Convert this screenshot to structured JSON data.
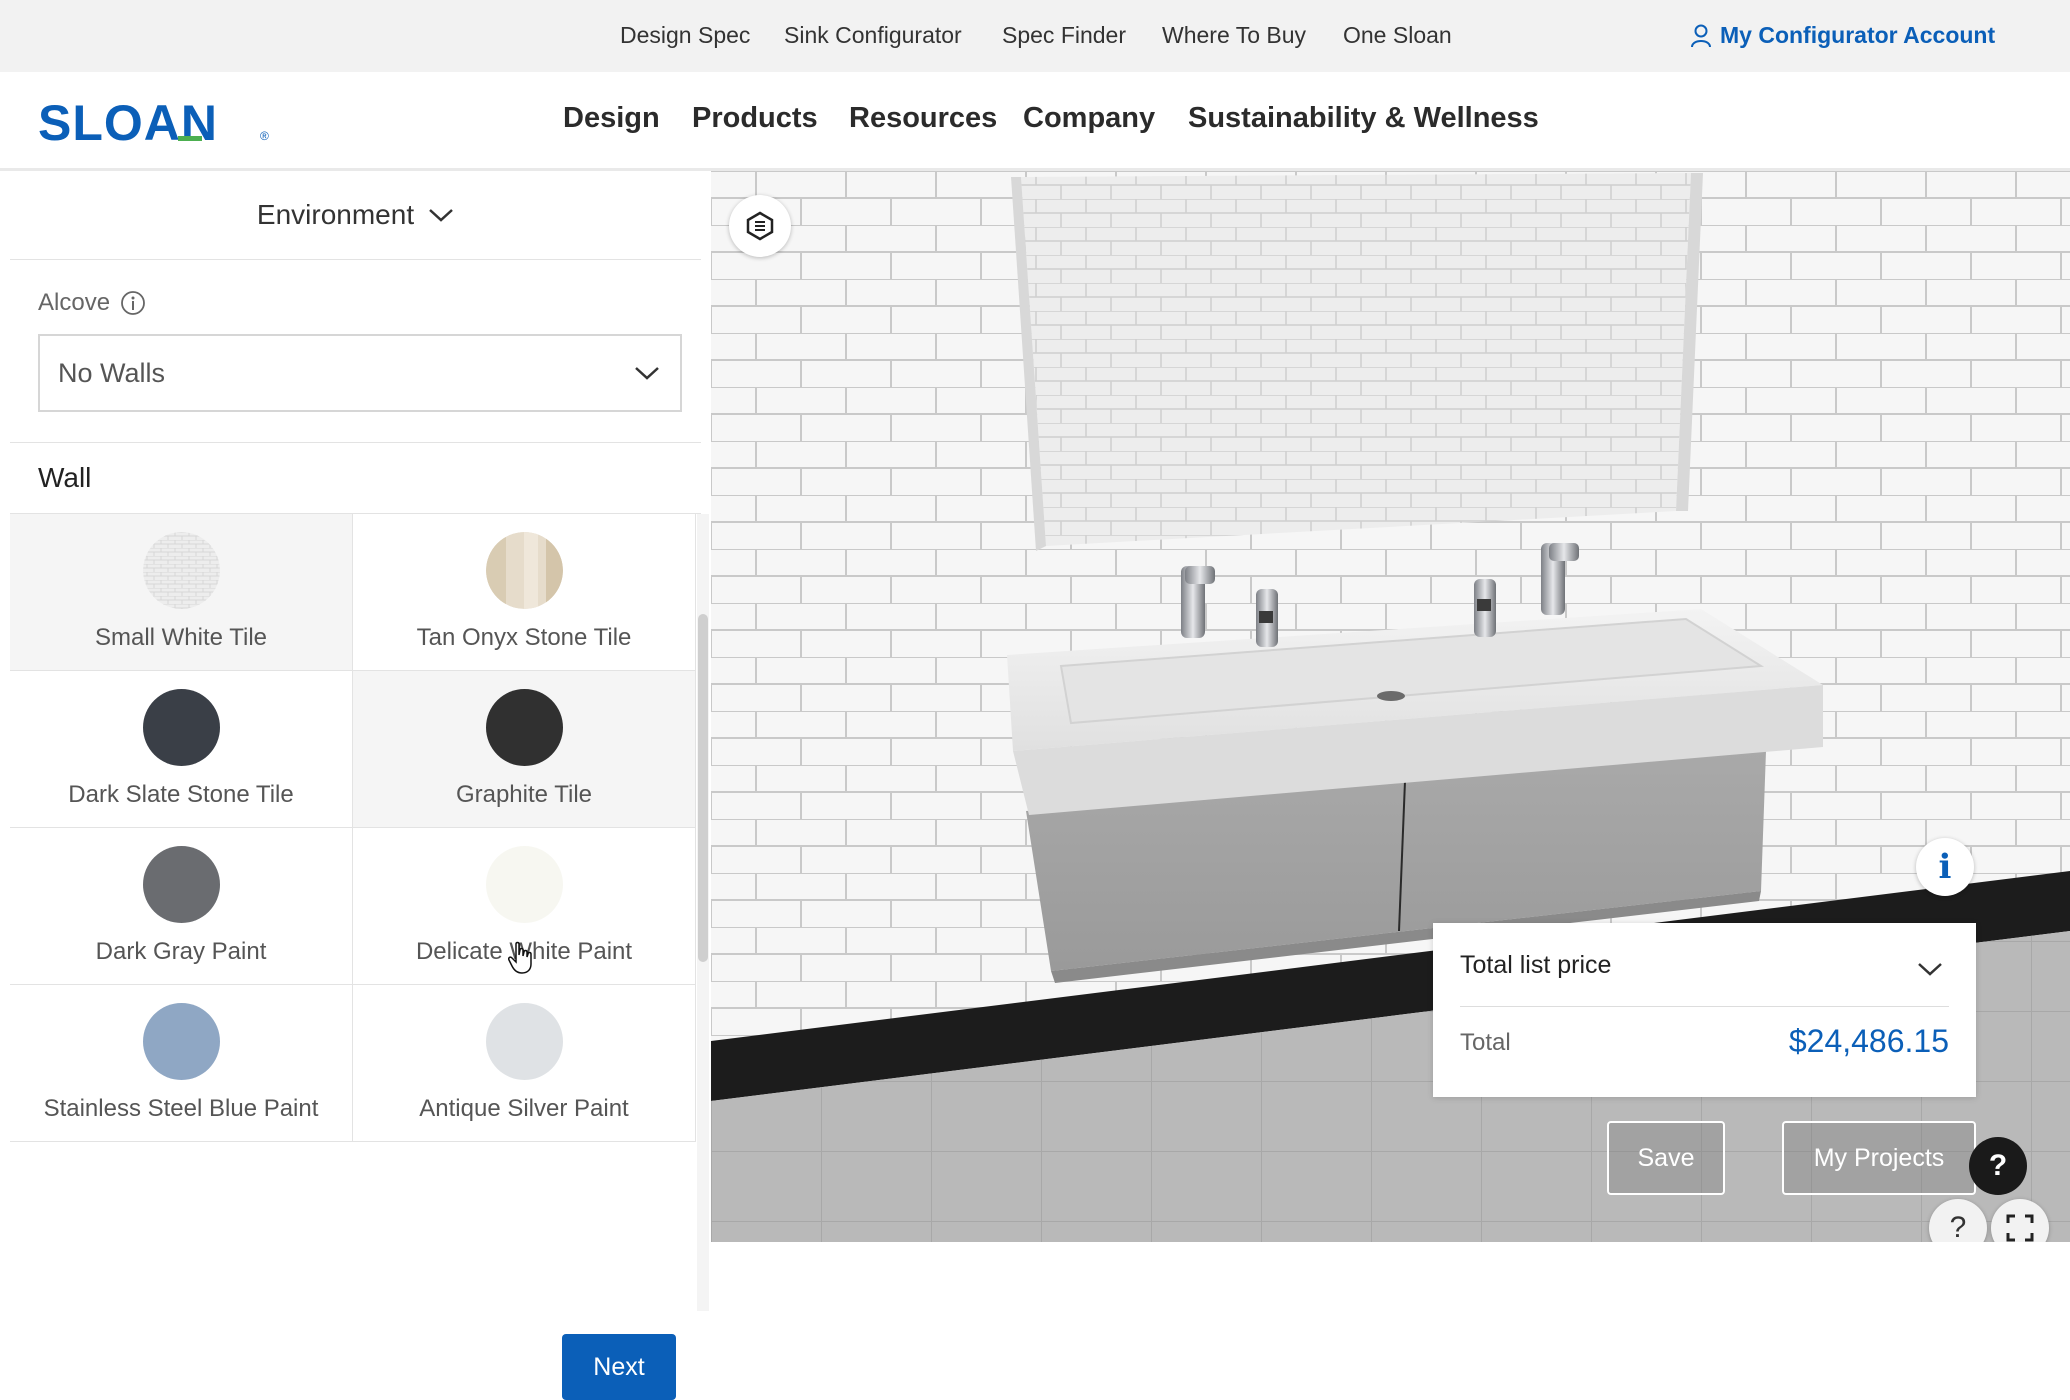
{
  "utility_nav": {
    "links": [
      "Design Spec",
      "Sink Configurator",
      "Spec Finder",
      "Where To Buy",
      "One Sloan"
    ],
    "account": "My Configurator Account"
  },
  "brand": {
    "logo_text": "SLOAN",
    "registered": "®"
  },
  "main_nav": [
    "Design",
    "Products",
    "Resources",
    "Company",
    "Sustainability & Wellness"
  ],
  "panel": {
    "section_title": "Environment",
    "alcove_label": "Alcove",
    "alcove_value": "No Walls",
    "wall_heading": "Wall",
    "swatches": [
      {
        "name": "Small White Tile",
        "color": "#ececec"
      },
      {
        "name": "Tan Onyx Stone Tile",
        "color": "#e3dac8"
      },
      {
        "name": "Dark Slate Stone Tile",
        "color": "#3a3f47"
      },
      {
        "name": "Graphite Tile",
        "color": "#303030"
      },
      {
        "name": "Dark Gray Paint",
        "color": "#6a6c70"
      },
      {
        "name": "Delicate White Paint",
        "color": "#f7f7f1"
      },
      {
        "name": "Stainless Steel Blue Paint",
        "color": "#8fa7c4"
      },
      {
        "name": "Antique Silver Paint",
        "color": "#dfe2e5"
      }
    ],
    "next_label": "Next"
  },
  "viewer": {
    "price_title": "Total list price",
    "total_label": "Total",
    "total_value": "$24,486.15",
    "save_label": "Save",
    "projects_label": "My Projects",
    "help_label": "?",
    "info_label": "i",
    "accent_color": "#0b5fb8"
  }
}
